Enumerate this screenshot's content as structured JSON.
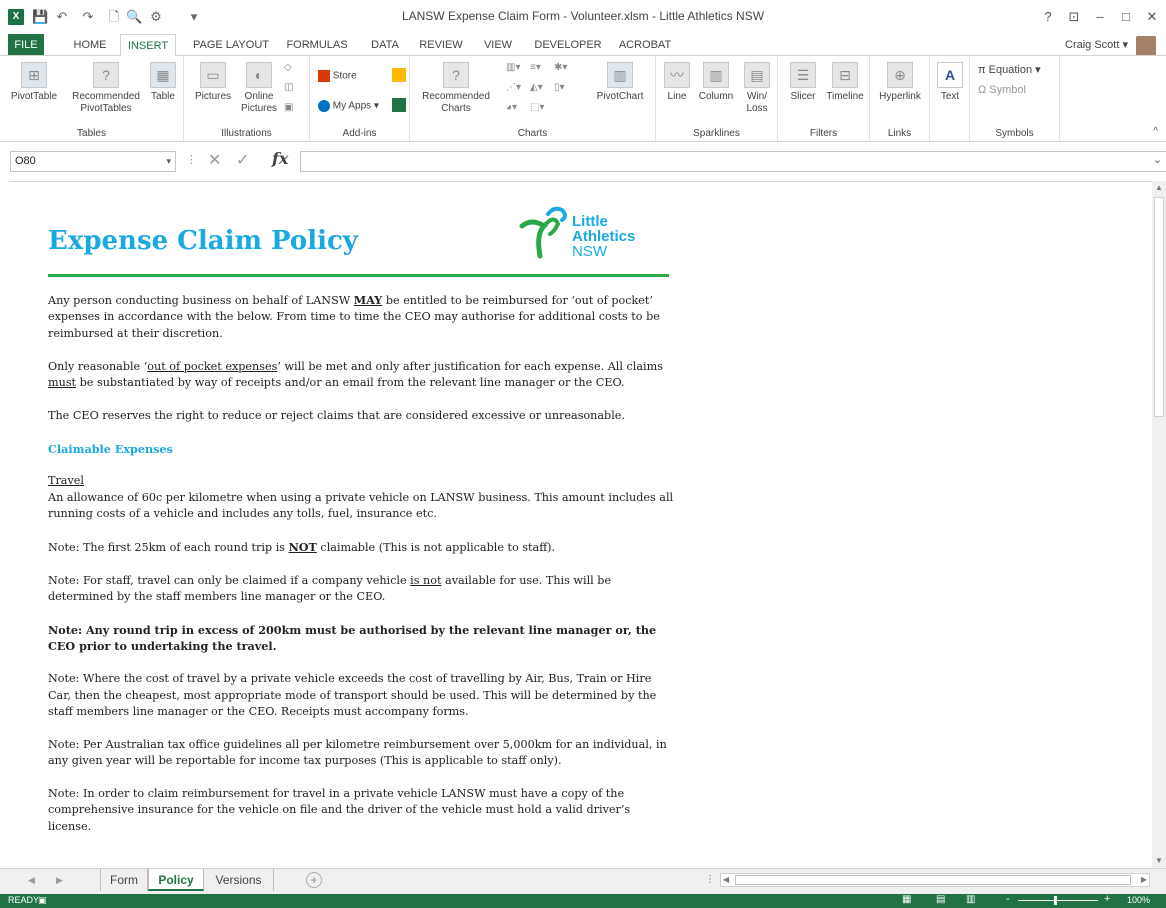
{
  "window": {
    "title": "LANSW Expense Claim Form - Volunteer.xlsm - Little Athletics NSW",
    "app_logo": "X",
    "help": "?",
    "controls": {
      "ribbon_options": "⊡",
      "minimize": "–",
      "maximize": "□",
      "close": "✕"
    }
  },
  "qat": {
    "save": "💾",
    "undo": "↶",
    "redo": "↷",
    "new": "🗋",
    "preview": "🔍",
    "extra": "⚙",
    "customize": "▾"
  },
  "ribbon_tabs": [
    {
      "label": "FILE"
    },
    {
      "label": "HOME"
    },
    {
      "label": "INSERT"
    },
    {
      "label": "PAGE LAYOUT"
    },
    {
      "label": "FORMULAS"
    },
    {
      "label": "DATA"
    },
    {
      "label": "REVIEW"
    },
    {
      "label": "VIEW"
    },
    {
      "label": "DEVELOPER"
    },
    {
      "label": "ACROBAT"
    }
  ],
  "active_tab": "INSERT",
  "user": {
    "name": "Craig Scott ▾"
  },
  "ribbon": {
    "tables": {
      "label": "Tables",
      "pivottable": "PivotTable",
      "recommended_pivot": "Recommended PivotTables",
      "table": "Table"
    },
    "illustrations": {
      "label": "Illustrations",
      "pictures": "Pictures",
      "online_pictures": "Online Pictures"
    },
    "addins": {
      "label": "Add-ins",
      "store": "Store",
      "my_apps": "My Apps ▾"
    },
    "charts": {
      "label": "Charts",
      "recommended": "Recommended Charts",
      "pivotchart": "PivotChart"
    },
    "sparklines": {
      "label": "Sparklines",
      "line": "Line",
      "column": "Column",
      "winloss": "Win/ Loss"
    },
    "filters": {
      "label": "Filters",
      "slicer": "Slicer",
      "timeline": "Timeline"
    },
    "links": {
      "label": "Links",
      "hyperlink": "Hyperlink"
    },
    "text": {
      "label": "Text"
    },
    "symbols": {
      "label": "Symbols",
      "equation": "π Equation ▾",
      "symbol": "Ω Symbol"
    }
  },
  "formula_bar": {
    "name_box": "O80",
    "fx": "fx",
    "cancel": "✕",
    "enter": "✓",
    "formula": ""
  },
  "policy": {
    "title": "Expense Claim Policy",
    "logo": {
      "line1": "Little",
      "line2": "Athletics",
      "line3": "NSW"
    },
    "p1_a": "Any person conducting business on behalf of LANSW ",
    "p1_b": "MAY",
    "p1_c": " be entitled to be reimbursed for ‘out of pocket’ expenses in accordance with the below. From time to time the CEO may authorise for additional costs to be reimbursed at their discretion.",
    "p2_a": "Only reasonable ‘",
    "p2_b": "out of pocket expenses",
    "p2_c": "’ will be met and only after justification for each expense. All claims ",
    "p2_d": "must",
    "p2_e": " be substantiated by way of receipts and/or an email from the relevant line manager or the CEO.",
    "p3": "The CEO reserves the right to reduce or reject claims that are considered excessive or unreasonable.",
    "claimable_heading": "Claimable Expenses",
    "travel_heading": "Travel",
    "travel_text": "An allowance of 60c per kilometre when using a private vehicle on LANSW business. This amount includes all running costs of a vehicle and includes any tolls, fuel, insurance etc.",
    "note1_a": "Note: The first 25km of each round trip is ",
    "note1_b": "NOT",
    "note1_c": " claimable (This is not applicable to staff).",
    "note2_a": "Note: For staff, travel can only be claimed if a company vehicle ",
    "note2_b": "is not",
    "note2_c": " available for use. This will be determined by the staff members line manager or the CEO.",
    "note3": "Note: Any round trip in excess of 200km must be authorised by the relevant line manager or, the CEO prior to undertaking the travel.",
    "note4": "Note: Where the cost of travel by a private vehicle exceeds the cost of travelling by Air, Bus, Train or Hire Car, then the cheapest, most appropriate mode of transport should be used. This will be determined by the staff members line manager or the CEO. Receipts must accompany forms.",
    "note5": "Note: Per Australian tax office guidelines all per kilometre reimbursement over 5,000km for an individual, in any given year will be reportable for income tax purposes (This is applicable to staff only).",
    "note6": "Note: In order to claim reimbursement for travel in a private vehicle LANSW must have a copy of the comprehensive insurance for the vehicle on file and the driver of the vehicle must hold a valid driver’s license."
  },
  "sheet_tabs": [
    {
      "label": "Form"
    },
    {
      "label": "Policy"
    },
    {
      "label": "Versions"
    }
  ],
  "active_sheet": "Policy",
  "status": {
    "ready": "READY",
    "zoom": "100%",
    "zoom_minus": "-",
    "zoom_plus": "+"
  },
  "colors": {
    "excel_green": "#217346",
    "title_blue": "#1ba9e1",
    "rule_green": "#2aa84a"
  }
}
